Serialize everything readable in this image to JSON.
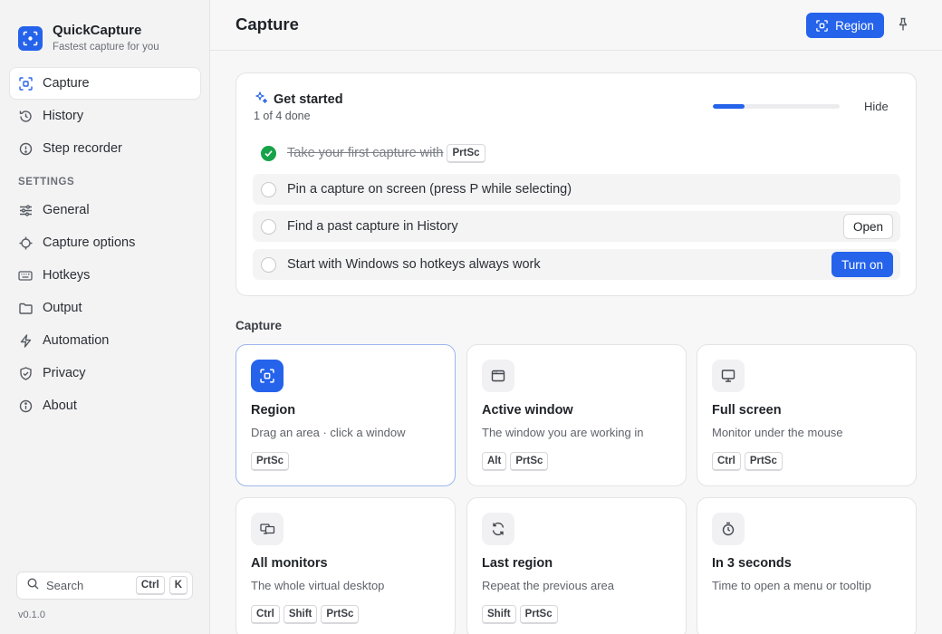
{
  "app": {
    "name": "QuickCapture",
    "tagline": "Fastest capture for you",
    "version": "v0.1.0"
  },
  "sidebar": {
    "primary": [
      {
        "label": "Capture",
        "icon": "capture-icon",
        "active": true
      },
      {
        "label": "History",
        "icon": "history-icon"
      },
      {
        "label": "Step recorder",
        "icon": "step-recorder-icon"
      }
    ],
    "settings_label": "SETTINGS",
    "settings": [
      {
        "label": "General",
        "icon": "sliders-icon"
      },
      {
        "label": "Capture options",
        "icon": "crosshair-icon"
      },
      {
        "label": "Hotkeys",
        "icon": "keyboard-icon"
      },
      {
        "label": "Output",
        "icon": "folder-icon"
      },
      {
        "label": "Automation",
        "icon": "bolt-icon"
      },
      {
        "label": "Privacy",
        "icon": "shield-icon"
      },
      {
        "label": "About",
        "icon": "info-icon"
      }
    ],
    "search": {
      "label": "Search",
      "keys": [
        "Ctrl",
        "K"
      ]
    }
  },
  "header": {
    "title": "Capture",
    "region_button": "Region"
  },
  "get_started": {
    "title": "Get started",
    "progress_text": "1 of 4 done",
    "progress_fraction": 0.25,
    "hide_label": "Hide",
    "tasks": [
      {
        "text": "Take your first capture with",
        "key": "PrtSc",
        "done": true
      },
      {
        "text": "Pin a capture on screen (press P while selecting)",
        "done": false
      },
      {
        "text": "Find a past capture in History",
        "done": false,
        "action": "Open"
      },
      {
        "text": "Start with Windows so hotkeys always work",
        "done": false,
        "action": "Turn on"
      }
    ]
  },
  "capture_section": {
    "label": "Capture",
    "tiles": [
      {
        "title": "Region",
        "desc": "Drag an area · click a window",
        "keys": [
          "PrtSc"
        ],
        "icon": "region-icon",
        "selected": true
      },
      {
        "title": "Active window",
        "desc": "The window you are working in",
        "keys": [
          "Alt",
          "PrtSc"
        ],
        "icon": "window-icon"
      },
      {
        "title": "Full screen",
        "desc": "Monitor under the mouse",
        "keys": [
          "Ctrl",
          "PrtSc"
        ],
        "icon": "monitor-icon"
      },
      {
        "title": "All monitors",
        "desc": "The whole virtual desktop",
        "keys": [
          "Ctrl",
          "Shift",
          "PrtSc"
        ],
        "icon": "monitors-icon"
      },
      {
        "title": "Last region",
        "desc": "Repeat the previous area",
        "keys": [
          "Shift",
          "PrtSc"
        ],
        "icon": "repeat-icon"
      },
      {
        "title": "In 3 seconds",
        "desc": "Time to open a menu or tooltip",
        "keys": [],
        "icon": "timer-icon"
      }
    ]
  },
  "colors": {
    "accent": "#2563eb",
    "success": "#16a34a"
  }
}
